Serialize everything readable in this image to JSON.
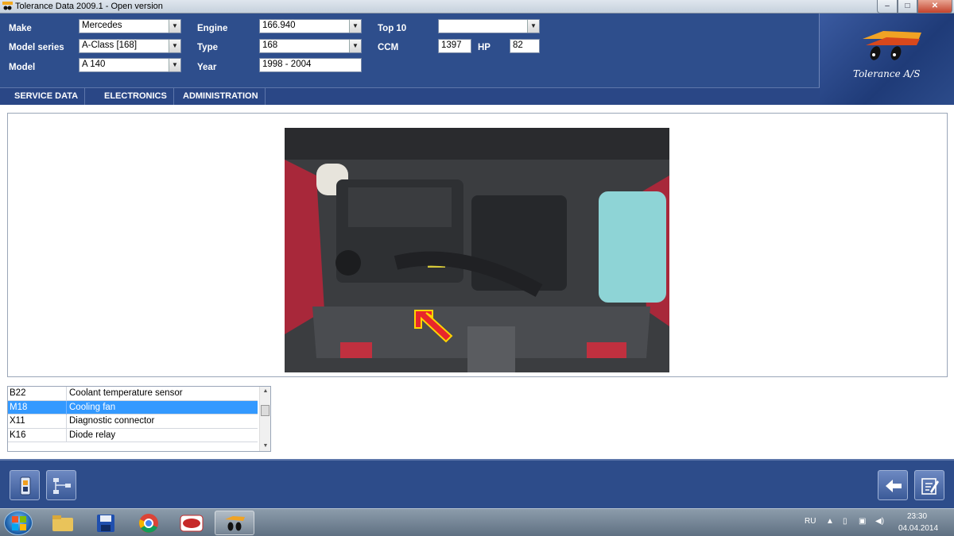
{
  "window": {
    "title": "Tolerance Data 2009.1 - Open version",
    "minimize": "–",
    "maximize": "□",
    "close": "✕"
  },
  "fields": {
    "make": {
      "label": "Make",
      "value": "Mercedes"
    },
    "model_series": {
      "label": "Model series",
      "value": "A-Class [168]"
    },
    "model": {
      "label": "Model",
      "value": "A 140"
    },
    "engine": {
      "label": "Engine",
      "value": "166.940"
    },
    "type": {
      "label": "Type",
      "value": "168"
    },
    "year": {
      "label": "Year",
      "value": "1998 - 2004"
    },
    "top10": {
      "label": "Top 10",
      "value": ""
    },
    "ccm": {
      "label": "CCM",
      "value": "1397"
    },
    "hp": {
      "label": "HP",
      "value": "82"
    }
  },
  "logo": {
    "text": "Tolerance A/S"
  },
  "menu": [
    "SERVICE DATA",
    "ELECTRONICS",
    "ADMINISTRATION"
  ],
  "components": [
    {
      "code": "B22",
      "name": "Coolant temperature sensor",
      "selected": false
    },
    {
      "code": "M18",
      "name": "Cooling fan",
      "selected": true
    },
    {
      "code": "X11",
      "name": "Diagnostic connector",
      "selected": false
    },
    {
      "code": "K16",
      "name": "Diode relay",
      "selected": false
    }
  ],
  "toolbar": {
    "left_buttons": [
      "component-locator-icon",
      "wiring-diagram-icon"
    ],
    "right_buttons": [
      "back-arrow-icon",
      "notes-edit-icon"
    ]
  },
  "taskbar": {
    "apps": [
      "explorer-icon",
      "save-icon",
      "chrome-icon",
      "wow-icon",
      "tolerance-app-icon"
    ],
    "language": "RU",
    "time": "23:30",
    "date": "04.04.2014"
  },
  "colors": {
    "header_bg": "#2e4e8c",
    "selection": "#3399ff",
    "indicator_arrow": "#e8262b"
  }
}
